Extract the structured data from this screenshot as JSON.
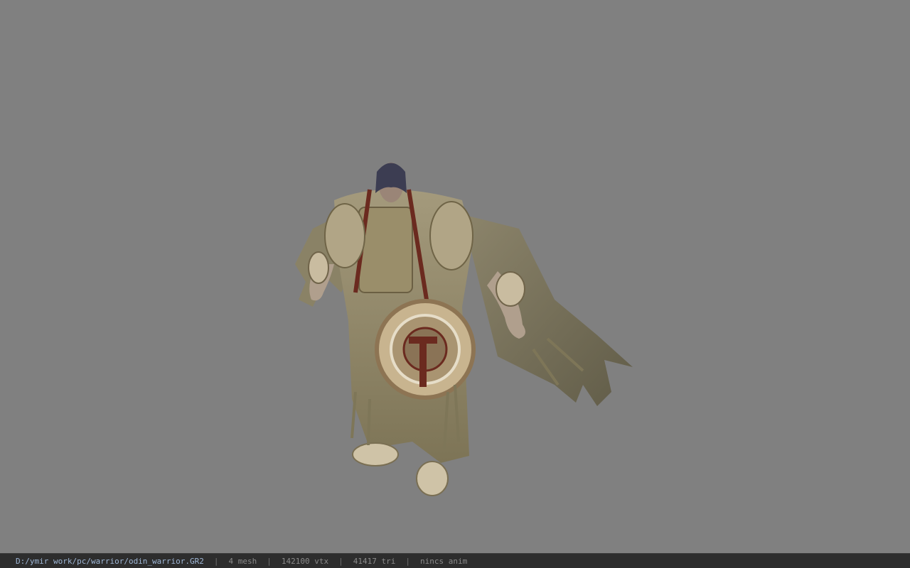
{
  "statusbar": {
    "file_path": "D:/ymir work/pc/warrior/odin_warrior.GR2",
    "separator": "|",
    "mesh_count": "4 mesh",
    "vertex_count": "142100 vtx",
    "triangle_count": "41417 tri",
    "animation": "nincs anim"
  },
  "viewport": {
    "background_color": "#808080"
  },
  "colors": {
    "statusbar_bg": "#2d2d2d",
    "path_text": "#9fb7d6",
    "stat_text": "#8a8a8a"
  }
}
